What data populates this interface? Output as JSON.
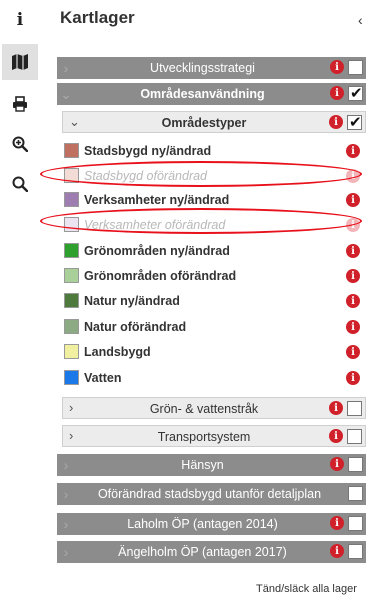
{
  "toolbar": {
    "items": [
      {
        "name": "info-icon",
        "glyph": "i"
      },
      {
        "name": "map-icon"
      },
      {
        "name": "print-icon"
      },
      {
        "name": "zoom-in-icon"
      },
      {
        "name": "search-icon"
      }
    ]
  },
  "panel": {
    "title": "Kartlager",
    "close": "‹"
  },
  "layers": {
    "utvecklingsstrategi": {
      "label": "Utvecklingsstrategi",
      "checked": false
    },
    "omradesanvandning": {
      "label": "Områdesanvändning",
      "checked": true
    },
    "omradestyper": {
      "label": "Områdestyper",
      "checked": true
    },
    "items": [
      {
        "label": "Stadsbygd ny/ändrad",
        "color": "#c07060",
        "dim": false
      },
      {
        "label": "Stadsbygd oförändrad",
        "color": "#f4dcd6",
        "dim": true
      },
      {
        "label": "Verksamheter ny/ändrad",
        "color": "#9e7eb0",
        "dim": false
      },
      {
        "label": "Verksamheter oförändrad",
        "color": "#ece4f0",
        "dim": true
      },
      {
        "label": "Grönområden ny/ändrad",
        "color": "#2ea02e",
        "dim": false
      },
      {
        "label": "Grönområden oförändrad",
        "color": "#a8d098",
        "dim": false
      },
      {
        "label": "Natur ny/ändrad",
        "color": "#4e7a3e",
        "dim": false
      },
      {
        "label": "Natur oförändrad",
        "color": "#8cab84",
        "dim": false
      },
      {
        "label": "Landsbygd",
        "color": "#f0f0a0",
        "dim": false
      },
      {
        "label": "Vatten",
        "color": "#1a78e8",
        "dim": false
      }
    ],
    "gron_vattenstrak": {
      "label": "Grön- & vattenstråk",
      "checked": false
    },
    "transportsystem": {
      "label": "Transportsystem",
      "checked": false
    },
    "hansyn": {
      "label": "Hänsyn",
      "checked": false
    },
    "oforandrad_stadsbygd": {
      "label": "Oförändrad stadsbygd utanför detaljplan",
      "checked": false
    },
    "laholm": {
      "label": "Laholm ÖP (antagen 2014)",
      "checked": false
    },
    "angelholm": {
      "label": "Ängelholm ÖP (antagen 2017)",
      "checked": false
    }
  },
  "info_glyph": "i",
  "footer": {
    "toggle_all": "Tänd/släck alla lager"
  },
  "colors": {
    "bar": "#8c8c8c",
    "info": "#d0202a",
    "highlight": "#e8101a"
  }
}
